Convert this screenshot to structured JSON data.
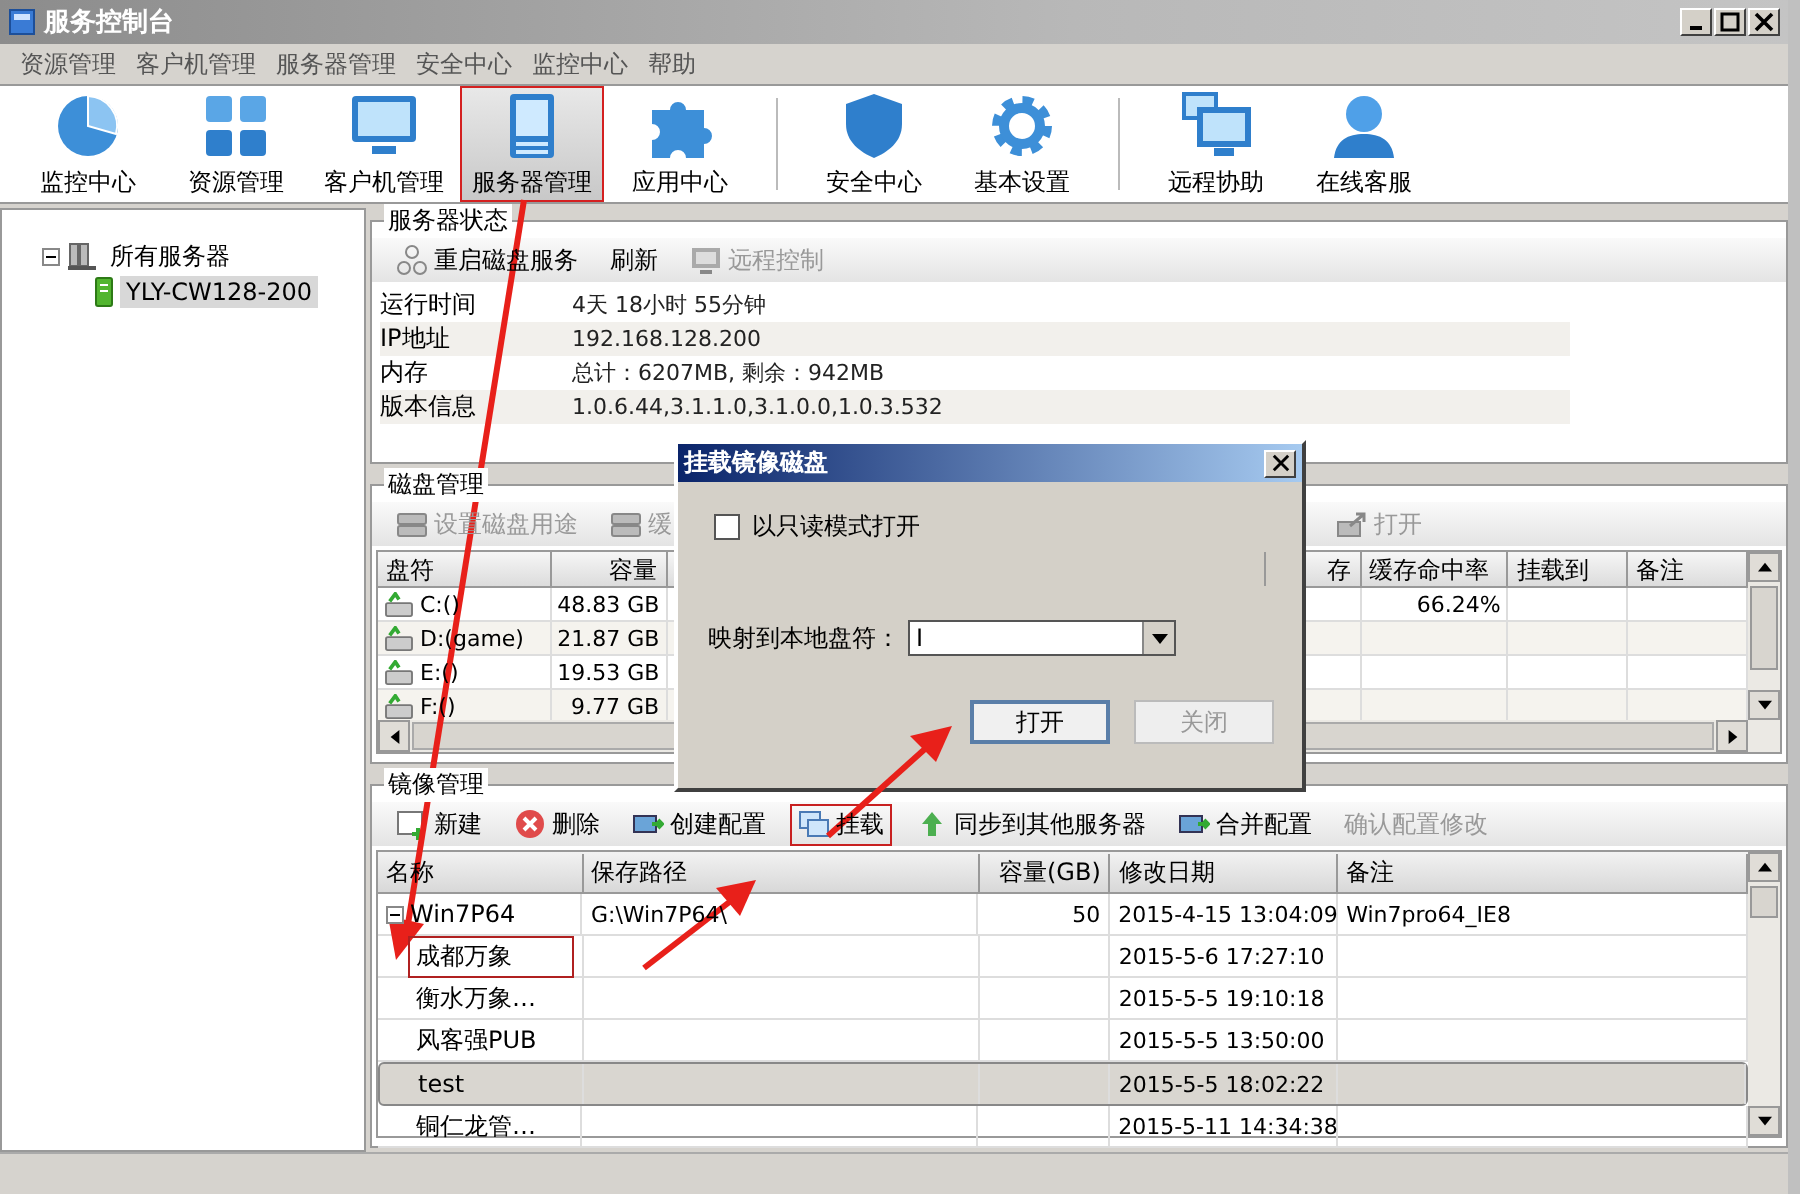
{
  "window": {
    "title": "服务控制台"
  },
  "menu": [
    "资源管理",
    "客户机管理",
    "服务器管理",
    "安全中心",
    "监控中心",
    "帮助"
  ],
  "toolbar_groups": [
    {
      "items": [
        {
          "label": "监控中心",
          "kind": "pie",
          "selected": false,
          "highlighted": false
        },
        {
          "label": "资源管理",
          "kind": "grid",
          "selected": false,
          "highlighted": false
        },
        {
          "label": "客户机管理",
          "kind": "monitor",
          "selected": false,
          "highlighted": false
        },
        {
          "label": "服务器管理",
          "kind": "server",
          "selected": true,
          "highlighted": true
        },
        {
          "label": "应用中心",
          "kind": "puzzle",
          "selected": false,
          "highlighted": false
        }
      ]
    },
    {
      "items": [
        {
          "label": "安全中心",
          "kind": "shield",
          "selected": false,
          "highlighted": false
        },
        {
          "label": "基本设置",
          "kind": "gear",
          "selected": false,
          "highlighted": false
        }
      ]
    },
    {
      "items": [
        {
          "label": "远程协助",
          "kind": "remote",
          "selected": false,
          "highlighted": false
        },
        {
          "label": "在线客服",
          "kind": "user",
          "selected": false,
          "highlighted": false
        }
      ]
    }
  ],
  "tree": {
    "label": "所有服务器",
    "expanded": true,
    "children": [
      {
        "label": "YLY-CW128-200",
        "selected": true
      }
    ]
  },
  "server_status": {
    "title": "服务器状态",
    "actions": [
      {
        "label": "重启磁盘服务",
        "kind": "network",
        "disabled": false
      },
      {
        "label": "刷新",
        "kind": "none",
        "disabled": false
      },
      {
        "label": "远程控制",
        "kind": "monitor",
        "disabled": true
      }
    ],
    "info": [
      {
        "label": "运行时间",
        "value": "4天 18小时 55分钟"
      },
      {
        "label": "IP地址",
        "value": "192.168.128.200"
      },
      {
        "label": "内存",
        "value": "总计：6207MB, 剩余：942MB"
      },
      {
        "label": "版本信息",
        "value": "1.0.6.44,3.1.1.0,3.1.0.0,1.0.3.532"
      }
    ]
  },
  "disk_management": {
    "title": "磁盘管理",
    "actions": [
      {
        "label": "设置磁盘用途",
        "kind": "disk",
        "disabled": true
      },
      {
        "label": "缓",
        "kind": "disk",
        "disabled": true
      },
      {
        "label": "打开",
        "kind": "open",
        "disabled": true
      }
    ],
    "columns": [
      "盘符",
      "容量",
      "",
      "存",
      "缓存命中率",
      "挂载到",
      "备注"
    ],
    "rows": [
      {
        "drive": "C:()",
        "size": "48.83 GB",
        "hit_rate": "66.24%"
      },
      {
        "drive": "D:(game)",
        "size": "21.87 GB"
      },
      {
        "drive": "E:()",
        "size": "19.53 GB"
      },
      {
        "drive": "F:()",
        "size": "9.77 GB"
      }
    ]
  },
  "image_management": {
    "title": "镜像管理",
    "actions": [
      {
        "label": "新建",
        "kind": "add",
        "disabled": false,
        "highlighted": false
      },
      {
        "label": "删除",
        "kind": "delete",
        "disabled": false,
        "highlighted": false
      },
      {
        "label": "创建配置",
        "kind": "config",
        "disabled": false,
        "highlighted": false
      },
      {
        "label": "挂载",
        "kind": "mount",
        "disabled": false,
        "highlighted": true
      },
      {
        "label": "同步到其他服务器",
        "kind": "sync",
        "disabled": false,
        "highlighted": false
      },
      {
        "label": "合并配置",
        "kind": "config",
        "disabled": false,
        "highlighted": false
      },
      {
        "label": "确认配置修改",
        "kind": "none",
        "disabled": true,
        "highlighted": false
      }
    ],
    "columns": [
      "名称",
      "保存路径",
      "容量(GB)",
      "修改日期",
      "备注"
    ],
    "rows": [
      {
        "name": "Win7P64",
        "path": "G:\\Win7P64\\",
        "size": "50",
        "date": "2015-4-15 13:04:09",
        "note": "Win7pro64_IE8",
        "expanded": true,
        "selected": false,
        "highlighted": false,
        "children": [
          {
            "name": "成都万象",
            "date": "2015-5-6 17:27:10",
            "selected": false,
            "highlighted": true
          },
          {
            "name": "衡水万象…",
            "date": "2015-5-5 19:10:18",
            "selected": false,
            "highlighted": false
          },
          {
            "name": "风客强PUB",
            "date": "2015-5-5 13:50:00",
            "selected": false,
            "highlighted": false
          },
          {
            "name": "test",
            "date": "2015-5-5 18:02:22",
            "selected": true,
            "highlighted": false
          },
          {
            "name": "铜仁龙管…",
            "date": "2015-5-11 14:34:38",
            "selected": false,
            "highlighted": false
          }
        ]
      }
    ]
  },
  "dialog": {
    "title": "挂载镜像磁盘",
    "checkbox": {
      "label": "以只读模式打开",
      "checked": false
    },
    "drive_label": "映射到本地盘符：",
    "drive_value": "I",
    "buttons": [
      {
        "label": "打开",
        "disabled": false
      },
      {
        "label": "关闭",
        "disabled": true
      }
    ]
  }
}
